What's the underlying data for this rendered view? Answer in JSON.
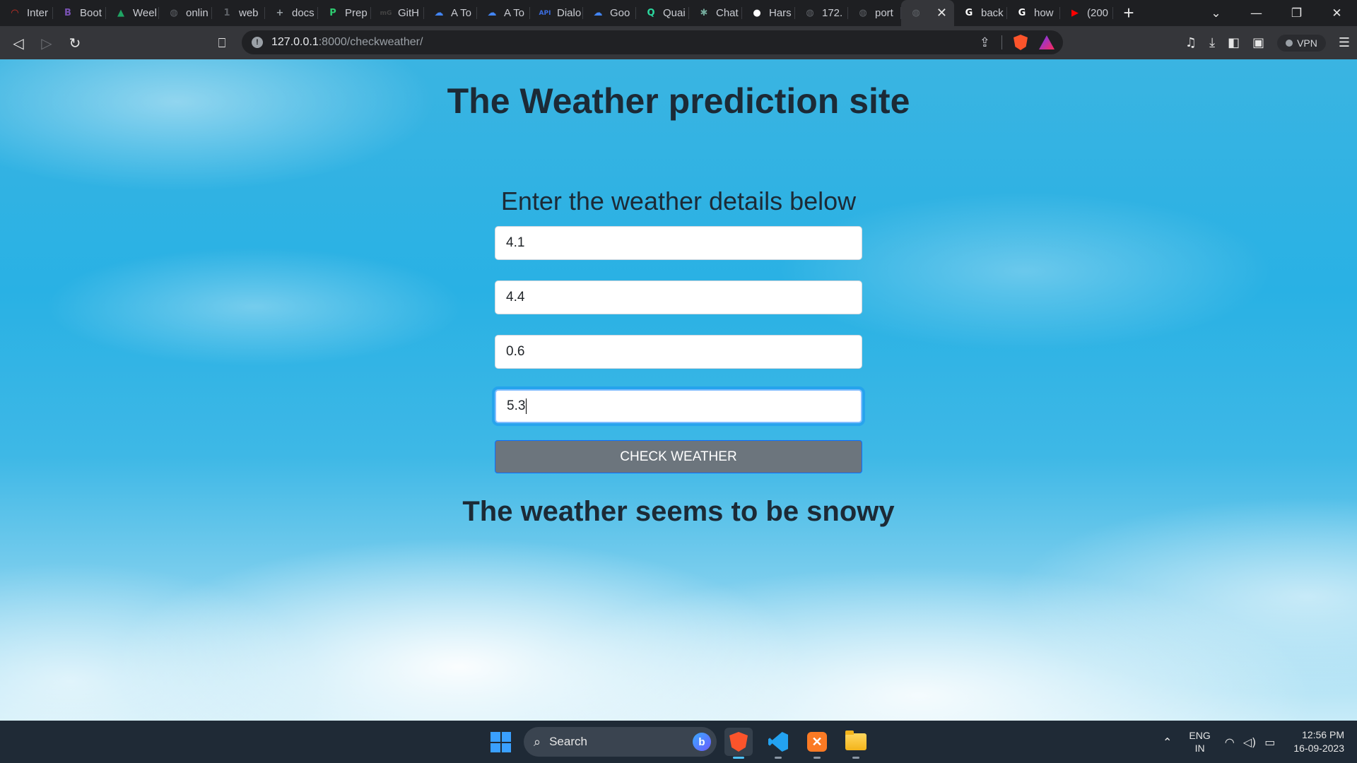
{
  "browser": {
    "tabs": [
      {
        "title": "Inter",
        "icon": "opera-icon",
        "color": "#d93025",
        "glyph": "◠"
      },
      {
        "title": "Boot",
        "icon": "bootstrap-icon",
        "color": "#7952b3",
        "glyph": "B"
      },
      {
        "title": "Weel",
        "icon": "google-drive-icon",
        "color": "#1fa463",
        "glyph": "▲"
      },
      {
        "title": "onlin",
        "icon": "globe-icon",
        "color": "#5f6368",
        "glyph": "◍"
      },
      {
        "title": "web",
        "icon": "one-icon",
        "color": "#5f6368",
        "glyph": "1"
      },
      {
        "title": "docs",
        "icon": "docs-icon",
        "color": "#9aa0a6",
        "glyph": "+"
      },
      {
        "title": "Prep",
        "icon": "prep-icon",
        "color": "#2ecc71",
        "glyph": "P"
      },
      {
        "title": "GitH",
        "icon": "mg-icon",
        "color": "#444",
        "glyph": "mG"
      },
      {
        "title": "A To",
        "icon": "gcloud-icon",
        "color": "#4285f4",
        "glyph": "☁"
      },
      {
        "title": "A To",
        "icon": "gcloud-icon",
        "color": "#4285f4",
        "glyph": "☁"
      },
      {
        "title": "Dialo",
        "icon": "api-icon",
        "color": "#3b6de0",
        "glyph": "API"
      },
      {
        "title": "Goo",
        "icon": "gcloud-icon",
        "color": "#4285f4",
        "glyph": "☁"
      },
      {
        "title": "Quai",
        "icon": "quarkus-icon",
        "color": "#2bd99f",
        "glyph": "Q"
      },
      {
        "title": "Chat",
        "icon": "chatgpt-icon",
        "color": "#74aa9c",
        "glyph": "✱"
      },
      {
        "title": "Hars",
        "icon": "github-icon",
        "color": "#fff",
        "glyph": "●"
      },
      {
        "title": "172.",
        "icon": "globe-icon",
        "color": "#5f6368",
        "glyph": "◍"
      },
      {
        "title": "port",
        "icon": "globe-icon",
        "color": "#5f6368",
        "glyph": "◍"
      },
      {
        "title": "",
        "icon": "globe-icon",
        "color": "#5f6368",
        "glyph": "◍",
        "active": true
      },
      {
        "title": "back",
        "icon": "google-icon",
        "color": "#fff",
        "glyph": "G"
      },
      {
        "title": "how",
        "icon": "google-icon",
        "color": "#fff",
        "glyph": "G"
      },
      {
        "title": "(200",
        "icon": "youtube-icon",
        "color": "#ff0000",
        "glyph": "▶"
      }
    ],
    "url_host": "127.0.0.1",
    "url_path": ":8000/checkweather/",
    "vpn_label": "VPN"
  },
  "page": {
    "title": "The Weather prediction site",
    "form_heading": "Enter the weather details below",
    "inputs": [
      {
        "value": "4.1"
      },
      {
        "value": "4.4"
      },
      {
        "value": "0.6"
      },
      {
        "value": "5.3",
        "focused": true
      }
    ],
    "submit_label": "CHECK WEATHER",
    "result": "The weather seems to be snowy"
  },
  "taskbar": {
    "search_label": "Search",
    "lang_line1": "ENG",
    "lang_line2": "IN",
    "time": "12:56 PM",
    "date": "16-09-2023"
  },
  "colors": {
    "button_bg": "#6c757d",
    "button_border": "#0d6efd",
    "focus_ring": "#80bdff"
  }
}
